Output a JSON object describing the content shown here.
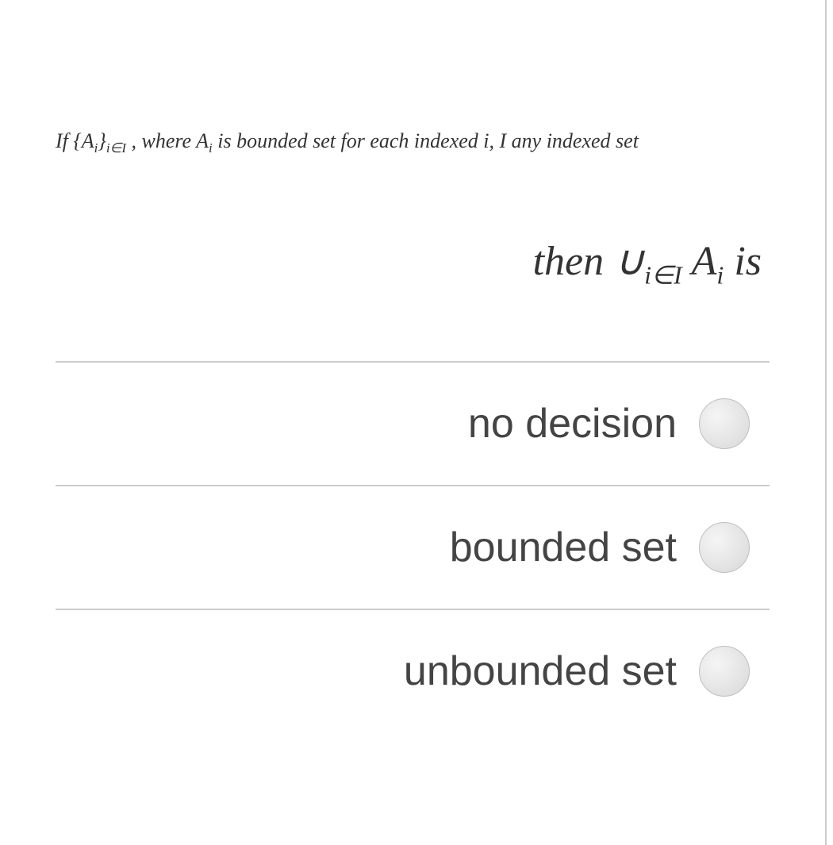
{
  "question": {
    "line1_parts": {
      "prefix": "If {A",
      "sub1": "i",
      "brace": "}",
      "sub2": "i∈I",
      "mid": " , where A",
      "sub3": "i",
      "rest": " is bounded set for each indexed i, I any indexed set"
    },
    "line2_parts": {
      "prefix": "then  ∪",
      "sub1": "i∈I",
      "mid": "  A",
      "sub2": "i",
      "rest": "  is"
    }
  },
  "options": [
    {
      "label": "no decision"
    },
    {
      "label": "bounded set"
    },
    {
      "label": "unbounded set"
    }
  ]
}
